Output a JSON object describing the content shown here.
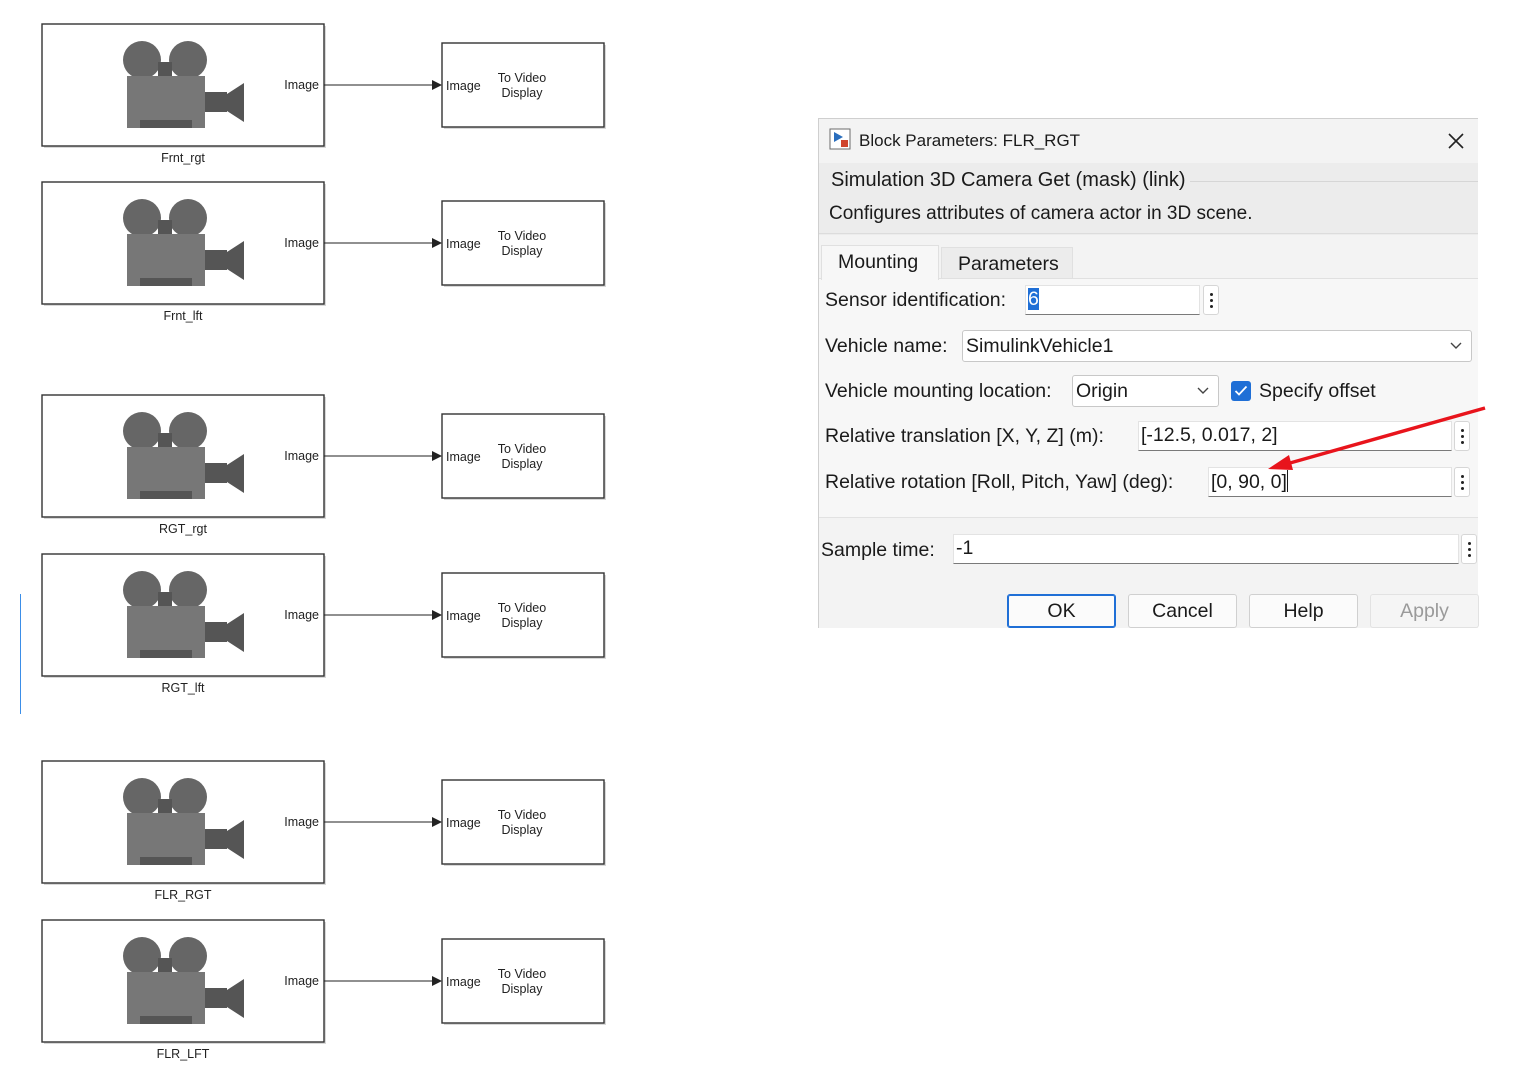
{
  "model": {
    "blocks": [
      {
        "name": "Frnt_rgt",
        "out_port": "Image",
        "display_in_port": "Image",
        "display_label_line1": "To Video",
        "display_label_line2": "Display"
      },
      {
        "name": "Frnt_lft",
        "out_port": "Image",
        "display_in_port": "Image",
        "display_label_line1": "To Video",
        "display_label_line2": "Display"
      },
      {
        "name": "RGT_rgt",
        "out_port": "Image",
        "display_in_port": "Image",
        "display_label_line1": "To Video",
        "display_label_line2": "Display"
      },
      {
        "name": "RGT_lft",
        "out_port": "Image",
        "display_in_port": "Image",
        "display_label_line1": "To Video",
        "display_label_line2": "Display"
      },
      {
        "name": "FLR_RGT",
        "out_port": "Image",
        "display_in_port": "Image",
        "display_label_line1": "To Video",
        "display_label_line2": "Display"
      },
      {
        "name": "FLR_LFT",
        "out_port": "Image",
        "display_in_port": "Image",
        "display_label_line1": "To Video",
        "display_label_line2": "Display"
      }
    ],
    "camera_icon": "movie-camera-icon"
  },
  "dialog": {
    "title": "Block Parameters: FLR_RGT",
    "mask_title": "Simulation 3D Camera Get (mask) (link)",
    "description": "Configures attributes of camera actor in 3D scene.",
    "tabs": [
      {
        "label": "Mounting",
        "active": true
      },
      {
        "label": "Parameters",
        "active": false
      }
    ],
    "fields": {
      "sensor_id_label": "Sensor identification:",
      "sensor_id_value": "6",
      "vehicle_name_label": "Vehicle name:",
      "vehicle_name_value": "SimulinkVehicle1",
      "mount_location_label": "Vehicle mounting location:",
      "mount_location_value": "Origin",
      "specify_offset_label": "Specify offset",
      "specify_offset_checked": true,
      "translation_label": "Relative translation [X, Y, Z] (m):",
      "translation_value": "[-12.5, 0.017, 2]",
      "rotation_label": "Relative rotation [Roll, Pitch, Yaw] (deg):",
      "rotation_value": "[0, 90, 0]",
      "sample_time_label": "Sample time:",
      "sample_time_value": "-1"
    },
    "buttons": {
      "ok": "OK",
      "cancel": "Cancel",
      "help": "Help",
      "apply": "Apply"
    }
  },
  "colors": {
    "accent": "#1f6fd6",
    "annotation_arrow": "#e8141c",
    "camera_icon": "#777777"
  }
}
